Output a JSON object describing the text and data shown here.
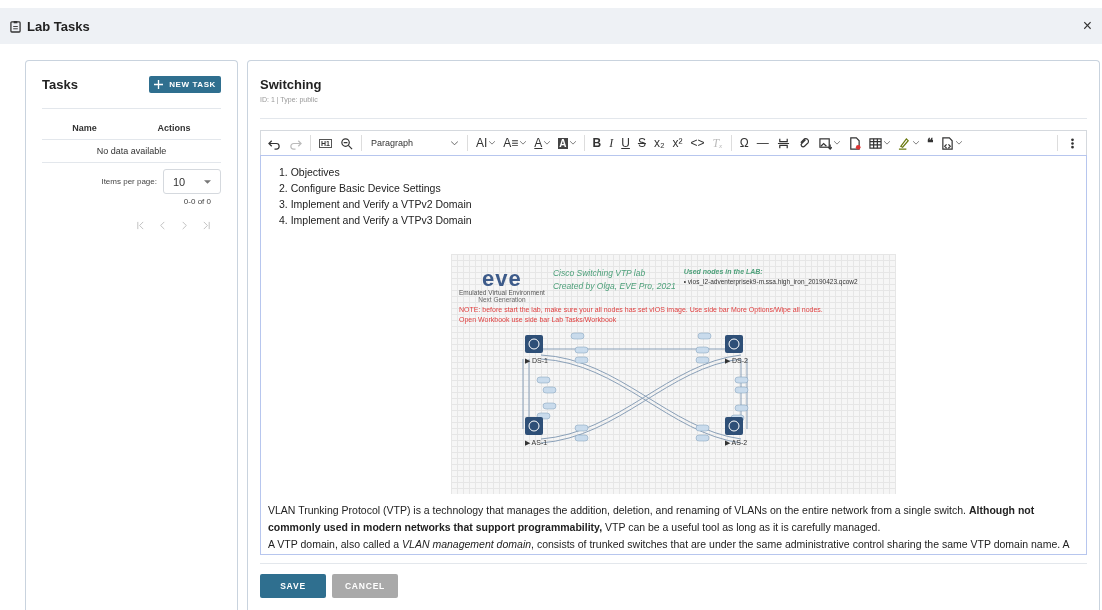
{
  "window": {
    "title": "Lab Tasks",
    "close": "×"
  },
  "tasks_panel": {
    "title": "Tasks",
    "new_button": "NEW TASK",
    "columns": [
      "Name",
      "Actions"
    ],
    "empty": "No data available",
    "items_per_page_label": "Items per page:",
    "items_per_page": "10",
    "range": "0-0 of 0",
    "pager": [
      {
        "kind": "first",
        "disabled": true
      },
      {
        "kind": "prev",
        "disabled": true
      },
      {
        "kind": "next",
        "disabled": true
      },
      {
        "kind": "last",
        "disabled": true
      }
    ]
  },
  "task": {
    "title": "Switching",
    "meta": "ID: 1 | Type: public",
    "toolbar": [
      {
        "kind": "undo",
        "disabled": false,
        "caret": false
      },
      {
        "kind": "redo",
        "disabled": true,
        "caret": false
      },
      {
        "kind": "sep"
      },
      {
        "kind": "boxed",
        "text": "H1",
        "disabled": false,
        "caret": false
      },
      {
        "kind": "find",
        "disabled": false,
        "caret": false
      },
      {
        "kind": "sep"
      },
      {
        "kind": "select",
        "text": "Paragraph"
      },
      {
        "kind": "sep"
      },
      {
        "kind": "glyph",
        "text": "AI",
        "disabled": false,
        "caret": true
      },
      {
        "kind": "glyph",
        "text": "A≡",
        "disabled": false,
        "caret": true
      },
      {
        "kind": "underlined",
        "text": "A",
        "disabled": false,
        "caret": true
      },
      {
        "kind": "filled",
        "text": "A",
        "disabled": false,
        "caret": true
      },
      {
        "kind": "sep"
      },
      {
        "kind": "bold",
        "text": "B",
        "disabled": false,
        "caret": false
      },
      {
        "kind": "italic",
        "text": "I",
        "disabled": false,
        "caret": false
      },
      {
        "kind": "underlined",
        "text": "U",
        "disabled": false,
        "caret": false
      },
      {
        "kind": "strike",
        "text": "S",
        "disabled": false,
        "caret": false
      },
      {
        "kind": "glyph",
        "text": "x₂",
        "disabled": false,
        "caret": false
      },
      {
        "kind": "glyph",
        "text": "x²",
        "disabled": false,
        "caret": false
      },
      {
        "kind": "glyph",
        "text": "<>",
        "disabled": false,
        "caret": false
      },
      {
        "kind": "italic",
        "text": "Tₓ",
        "disabled": true,
        "caret": false
      },
      {
        "kind": "sep"
      },
      {
        "kind": "glyph",
        "text": "Ω",
        "disabled": false,
        "caret": false
      },
      {
        "kind": "glyph",
        "text": "—",
        "disabled": false,
        "caret": false
      },
      {
        "kind": "pagebreak",
        "disabled": false,
        "caret": false
      },
      {
        "kind": "link",
        "disabled": false,
        "caret": false
      },
      {
        "kind": "image",
        "disabled": false,
        "caret": true
      },
      {
        "kind": "file",
        "disabled": false,
        "caret": false
      },
      {
        "kind": "table",
        "disabled": false,
        "caret": true
      },
      {
        "kind": "highlight",
        "disabled": false,
        "caret": true
      },
      {
        "kind": "bold",
        "text": "❝",
        "disabled": false,
        "caret": false
      },
      {
        "kind": "source",
        "disabled": false,
        "caret": true
      },
      {
        "kind": "spacer"
      },
      {
        "kind": "sep"
      },
      {
        "kind": "more",
        "disabled": false,
        "caret": false
      }
    ],
    "objectives": [
      "1. Objectives",
      "2. Configure Basic Device Settings",
      "3. Implement and Verify a VTPv2 Domain",
      "4. Implement and Verify a VTPv3 Domain"
    ],
    "figure": {
      "logo": "eve",
      "logo_sub": "Emulated Virtual Environment",
      "logo_sub2": "Next Generation",
      "title": "Cisco Switching VTP lab",
      "credit": "Created by Olga, EVE Pro, 2021",
      "nodes_heading": "Used nodes in the LAB:",
      "nodes": [
        "• vios_l2-adventerprisek9-m.ssa.high_iron_20190423.qcow2"
      ],
      "notes": [
        "NOTE: before start the lab, make sure your all nodes has set vIOS image. Use side bar More Options/Wipe all nodes.",
        "Open Workbook use side bar  Lab Tasks/Workbook"
      ],
      "switches": [
        "▶ DS-1",
        "▶ DS-2",
        "▶ AS-1",
        "▶ AS-2"
      ]
    },
    "paragraphs": [
      "VLAN Trunking Protocol (VTP) is a technology that manages the addition, deletion, and renaming of VLANs on the entire network from a single switch. **Although not commonly used in modern networks that support programmability,** VTP can be a useful tool as long as it is carefully managed.",
      "A VTP domain, also called a *VLAN management domain*, consists of trunked switches that are under the same administrative control sharing the same VTP domain name. A"
    ],
    "buttons": [
      {
        "label": "SAVE",
        "disabled": false
      },
      {
        "label": "CANCEL",
        "disabled": true
      }
    ]
  }
}
